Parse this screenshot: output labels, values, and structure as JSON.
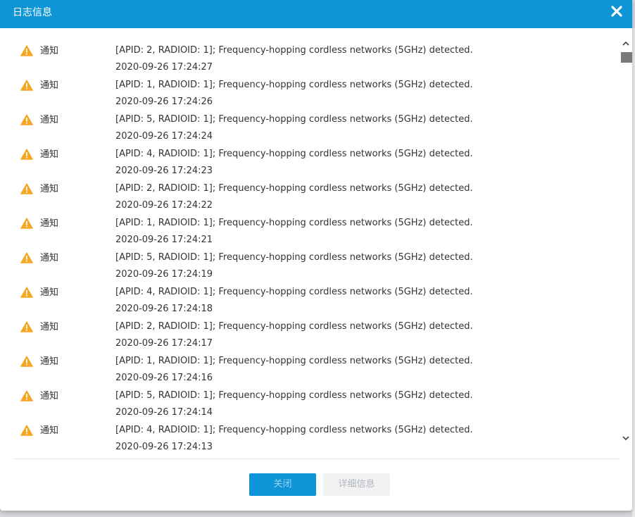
{
  "dialog": {
    "title": "日志信息",
    "close_icon": "close-x-icon"
  },
  "log": {
    "entries": [
      {
        "level": "通知",
        "icon": "warning-icon",
        "message": "[APID: 2, RADIOID: 1]; Frequency-hopping cordless networks (5GHz) detected.",
        "time": "2020-09-26 17:24:27"
      },
      {
        "level": "通知",
        "icon": "warning-icon",
        "message": "[APID: 1, RADIOID: 1]; Frequency-hopping cordless networks (5GHz) detected.",
        "time": "2020-09-26 17:24:26"
      },
      {
        "level": "通知",
        "icon": "warning-icon",
        "message": "[APID: 5, RADIOID: 1]; Frequency-hopping cordless networks (5GHz) detected.",
        "time": "2020-09-26 17:24:24"
      },
      {
        "level": "通知",
        "icon": "warning-icon",
        "message": "[APID: 4, RADIOID: 1]; Frequency-hopping cordless networks (5GHz) detected.",
        "time": "2020-09-26 17:24:23"
      },
      {
        "level": "通知",
        "icon": "warning-icon",
        "message": "[APID: 2, RADIOID: 1]; Frequency-hopping cordless networks (5GHz) detected.",
        "time": "2020-09-26 17:24:22"
      },
      {
        "level": "通知",
        "icon": "warning-icon",
        "message": "[APID: 1, RADIOID: 1]; Frequency-hopping cordless networks (5GHz) detected.",
        "time": "2020-09-26 17:24:21"
      },
      {
        "level": "通知",
        "icon": "warning-icon",
        "message": "[APID: 5, RADIOID: 1]; Frequency-hopping cordless networks (5GHz) detected.",
        "time": "2020-09-26 17:24:19"
      },
      {
        "level": "通知",
        "icon": "warning-icon",
        "message": "[APID: 4, RADIOID: 1]; Frequency-hopping cordless networks (5GHz) detected.",
        "time": "2020-09-26 17:24:18"
      },
      {
        "level": "通知",
        "icon": "warning-icon",
        "message": "[APID: 2, RADIOID: 1]; Frequency-hopping cordless networks (5GHz) detected.",
        "time": "2020-09-26 17:24:17"
      },
      {
        "level": "通知",
        "icon": "warning-icon",
        "message": "[APID: 1, RADIOID: 1]; Frequency-hopping cordless networks (5GHz) detected.",
        "time": "2020-09-26 17:24:16"
      },
      {
        "level": "通知",
        "icon": "warning-icon",
        "message": "[APID: 5, RADIOID: 1]; Frequency-hopping cordless networks (5GHz) detected.",
        "time": "2020-09-26 17:24:14"
      },
      {
        "level": "通知",
        "icon": "warning-icon",
        "message": "[APID: 4, RADIOID: 1]; Frequency-hopping cordless networks (5GHz) detected.",
        "time": "2020-09-26 17:24:13"
      }
    ]
  },
  "footer": {
    "close_label": "关闭",
    "detail_label": "详细信息"
  },
  "colors": {
    "accent": "#0d95d8",
    "warning": "#f5a623",
    "text": "#333333"
  }
}
